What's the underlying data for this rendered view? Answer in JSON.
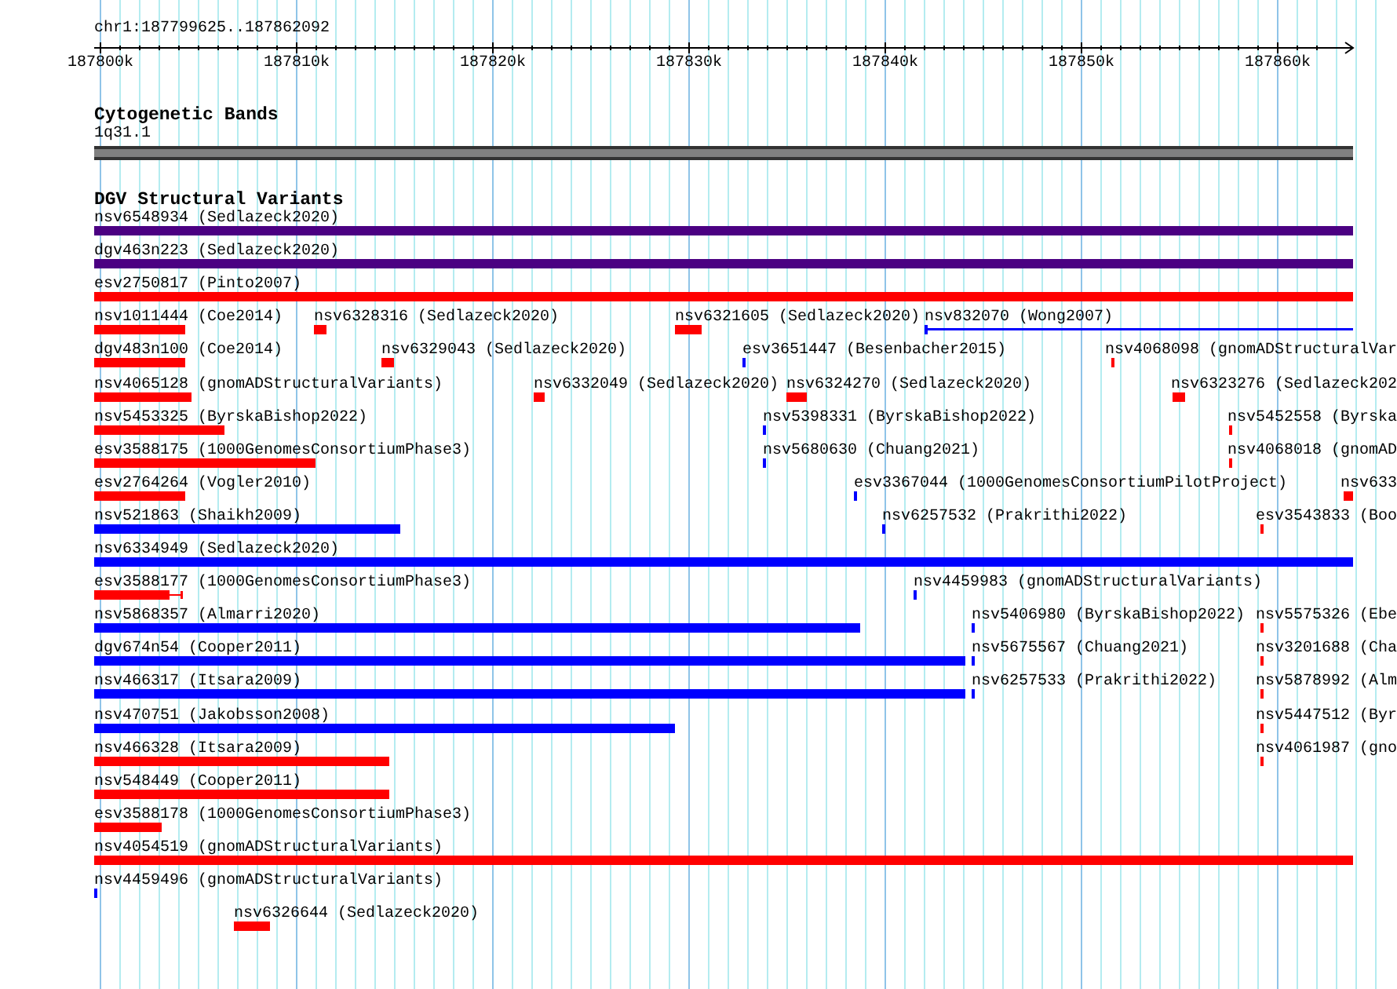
{
  "ruler": {
    "location": "chr1:187799625..187862092",
    "ticks": [
      "187800k",
      "187810k",
      "187820k",
      "187830k",
      "187840k",
      "187850k",
      "187860k"
    ]
  },
  "cytogenetic_bands": {
    "title": "Cytogenetic Bands",
    "band": "1q31.1"
  },
  "dgv_structural_variants": {
    "title": "DGV Structural Variants",
    "rows": [
      [
        {
          "label": "nsv6548934 (Sedlazeck2020)",
          "color": "#4b0082",
          "kind": "block"
        }
      ],
      [
        {
          "label": "dgv463n223 (Sedlazeck2020)",
          "color": "#4b0082",
          "kind": "block"
        }
      ],
      [
        {
          "label": "esv2750817 (Pinto2007)",
          "color": "#ff0000",
          "kind": "block"
        }
      ],
      [
        {
          "label": "nsv1011444 (Coe2014)",
          "color": "#ff0000",
          "kind": "block"
        },
        {
          "label": "nsv6328316 (Sedlazeck2020)",
          "color": "#ff0000",
          "kind": "block"
        },
        {
          "label": "nsv6321605 (Sedlazeck2020)",
          "color": "#ff0000",
          "kind": "block"
        },
        {
          "label": "nsv832070 (Wong2007)",
          "color": "#0000ff",
          "kind": "span"
        }
      ],
      [
        {
          "label": "dgv483n100 (Coe2014)",
          "color": "#ff0000",
          "kind": "block"
        },
        {
          "label": "nsv6329043 (Sedlazeck2020)",
          "color": "#ff0000",
          "kind": "block"
        },
        {
          "label": "esv3651447 (Besenbacher2015)",
          "color": "#0000ff",
          "kind": "block"
        },
        {
          "label": "nsv4068098 (gnomADStructuralVar",
          "color": "#ff0000",
          "kind": "block"
        }
      ],
      [
        {
          "label": "nsv4065128 (gnomADStructuralVariants)",
          "color": "#ff0000",
          "kind": "block"
        },
        {
          "label": "nsv6332049 (Sedlazeck2020)",
          "color": "#ff0000",
          "kind": "block"
        },
        {
          "label": "nsv6324270 (Sedlazeck2020)",
          "color": "#ff0000",
          "kind": "block"
        },
        {
          "label": "nsv6323276 (Sedlazeck202",
          "color": "#ff0000",
          "kind": "block"
        }
      ],
      [
        {
          "label": "nsv5453325 (ByrskaBishop2022)",
          "color": "#ff0000",
          "kind": "block"
        },
        {
          "label": "nsv5398331 (ByrskaBishop2022)",
          "color": "#0000ff",
          "kind": "block"
        },
        {
          "label": "nsv5452558 (Byrska",
          "color": "#ff0000",
          "kind": "block"
        }
      ],
      [
        {
          "label": "esv3588175 (1000GenomesConsortiumPhase3)",
          "color": "#ff0000",
          "kind": "block"
        },
        {
          "label": "nsv5680630 (Chuang2021)",
          "color": "#0000ff",
          "kind": "block"
        },
        {
          "label": "nsv4068018 (gnomAD",
          "color": "#ff0000",
          "kind": "block"
        }
      ],
      [
        {
          "label": "esv2764264 (Vogler2010)",
          "color": "#ff0000",
          "kind": "block"
        },
        {
          "label": "esv3367044 (1000GenomesConsortiumPilotProject)",
          "color": "#0000ff",
          "kind": "block"
        },
        {
          "label": "nsv633",
          "color": "#ff0000",
          "kind": "block"
        }
      ],
      [
        {
          "label": "nsv521863 (Shaikh2009)",
          "color": "#0000ff",
          "kind": "block"
        },
        {
          "label": "nsv6257532 (Prakrithi2022)",
          "color": "#0000ff",
          "kind": "block"
        },
        {
          "label": "esv3543833 (Boo",
          "color": "#ff0000",
          "kind": "block"
        }
      ],
      [
        {
          "label": "nsv6334949 (Sedlazeck2020)",
          "color": "#0000ff",
          "kind": "block"
        }
      ],
      [
        {
          "label": "esv3588177 (1000GenomesConsortiumPhase3)",
          "color": "#ff0000",
          "kind": "extended"
        },
        {
          "label": "nsv4459983 (gnomADStructuralVariants)",
          "color": "#0000ff",
          "kind": "block"
        }
      ],
      [
        {
          "label": "nsv5868357 (Almarri2020)",
          "color": "#0000ff",
          "kind": "block"
        },
        {
          "label": "nsv5406980 (ByrskaBishop2022)",
          "color": "#0000ff",
          "kind": "block"
        },
        {
          "label": "nsv5575326 (Ebe",
          "color": "#ff0000",
          "kind": "block"
        }
      ],
      [
        {
          "label": "dgv674n54 (Cooper2011)",
          "color": "#0000ff",
          "kind": "block"
        },
        {
          "label": "nsv5675567 (Chuang2021)",
          "color": "#0000ff",
          "kind": "block"
        },
        {
          "label": "nsv3201688 (Cha",
          "color": "#ff0000",
          "kind": "block"
        }
      ],
      [
        {
          "label": "nsv466317 (Itsara2009)",
          "color": "#0000ff",
          "kind": "block"
        },
        {
          "label": "nsv6257533 (Prakrithi2022)",
          "color": "#0000ff",
          "kind": "block"
        },
        {
          "label": "nsv5878992 (Alm",
          "color": "#ff0000",
          "kind": "block"
        }
      ],
      [
        {
          "label": "nsv470751 (Jakobsson2008)",
          "color": "#0000ff",
          "kind": "block"
        },
        {
          "label": "nsv5447512 (Byr",
          "color": "#ff0000",
          "kind": "block"
        }
      ],
      [
        {
          "label": "nsv466328 (Itsara2009)",
          "color": "#ff0000",
          "kind": "block"
        },
        {
          "label": "nsv4061987 (gno",
          "color": "#ff0000",
          "kind": "block"
        }
      ],
      [
        {
          "label": "nsv548449 (Cooper2011)",
          "color": "#ff0000",
          "kind": "block"
        }
      ],
      [
        {
          "label": "esv3588178 (1000GenomesConsortiumPhase3)",
          "color": "#ff0000",
          "kind": "block"
        }
      ],
      [
        {
          "label": "nsv4054519 (gnomADStructuralVariants)",
          "color": "#ff0000",
          "kind": "block"
        }
      ],
      [
        {
          "label": "nsv4459496 (gnomADStructuralVariants)",
          "color": "#0000ff",
          "kind": "block"
        }
      ],
      [
        {
          "label": "nsv6326644 (Sedlazeck2020)",
          "color": "#ff0000",
          "kind": "block"
        }
      ]
    ]
  }
}
